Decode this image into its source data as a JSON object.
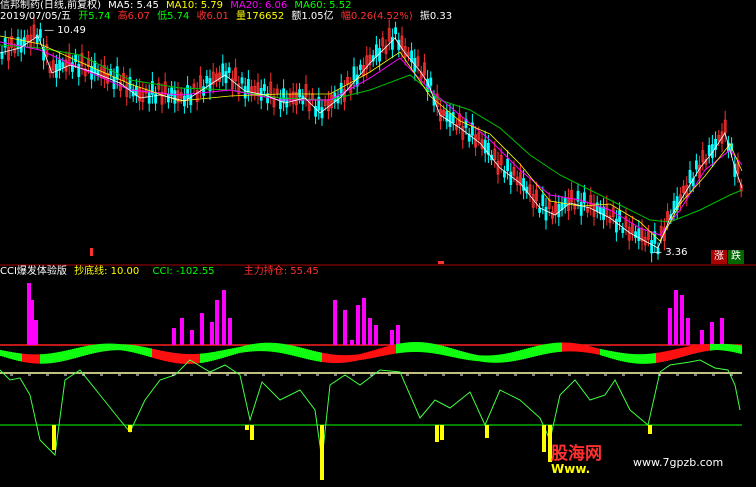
{
  "main": {
    "title": "信邦制药(日线,前复权)",
    "ma5_label": "MA5: 5.45",
    "ma10_label": "MA10: 5.79",
    "ma20_label": "MA20: 6.06",
    "ma60_label": "MA60: 5.52",
    "date": "2019/07/05/五",
    "open": "开5.74",
    "high": "高6.07",
    "low": "低5.74",
    "close": "收6.01",
    "volume": "量176652",
    "amount": "额1.05亿",
    "change": "幅0.26(4.52%)",
    "amplitude": "振0.33",
    "peak_label": "10.49",
    "trough_label": "3.36",
    "tag_up": "涨",
    "tag_down": "跌"
  },
  "indicator": {
    "title": "CCI爆发体验版",
    "bottom_line": "抄底线: 10.00",
    "cci": "CCI: -102.55",
    "main_holding": "主力持仓: 55.45"
  },
  "watermark": {
    "logo": "股海网",
    "logo_sub": "Www.",
    "url": "www.7gpzb.com"
  },
  "colors": {
    "white": "#ffffff",
    "yellow": "#ffff00",
    "magenta": "#ff00ff",
    "green": "#00ff00",
    "red": "#ff2020",
    "cyan": "#00ffff",
    "ma20": "#ff00ff",
    "ma60": "#00ff00",
    "ma10": "#ffff00"
  }
}
